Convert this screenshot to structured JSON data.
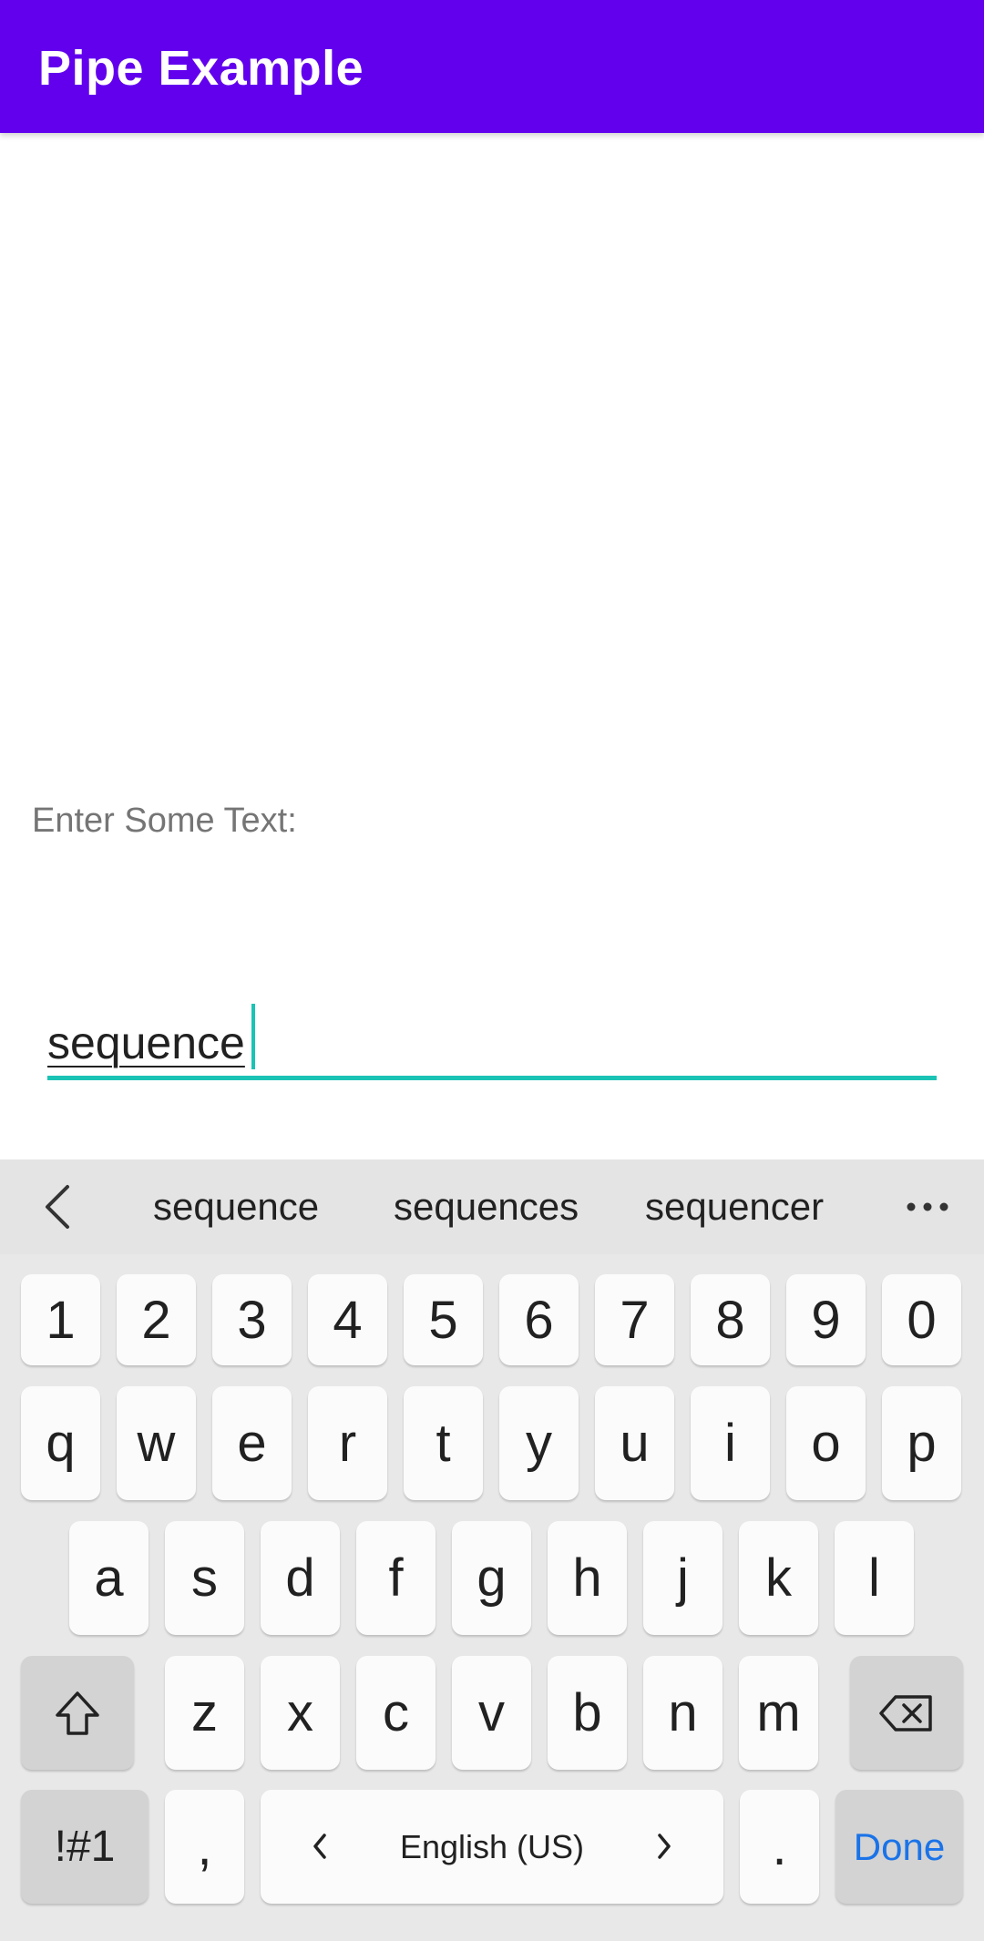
{
  "app_bar": {
    "title": "Pipe Example",
    "color": "#6200ee"
  },
  "form": {
    "label": "Enter Some Text:",
    "input_value": "sequence",
    "accent_color": "#1bc3b4"
  },
  "keyboard": {
    "suggestions": [
      "sequence",
      "sequences",
      "sequencer"
    ],
    "number_row": [
      "1",
      "2",
      "3",
      "4",
      "5",
      "6",
      "7",
      "8",
      "9",
      "0"
    ],
    "row1": [
      "q",
      "w",
      "e",
      "r",
      "t",
      "y",
      "u",
      "i",
      "o",
      "p"
    ],
    "row2": [
      "a",
      "s",
      "d",
      "f",
      "g",
      "h",
      "j",
      "k",
      "l"
    ],
    "row3": [
      "z",
      "x",
      "c",
      "v",
      "b",
      "n",
      "m"
    ],
    "symbols_key": "!#1",
    "comma_key": ",",
    "language": "English (US)",
    "period_key": ".",
    "done_key": "Done",
    "icons": {
      "back": "chevron-left-icon",
      "more": "more-horizontal-icon",
      "shift": "shift-icon",
      "backspace": "backspace-icon",
      "lang_prev": "chevron-left-icon",
      "lang_next": "chevron-right-icon"
    },
    "done_color": "#1a73e8"
  }
}
